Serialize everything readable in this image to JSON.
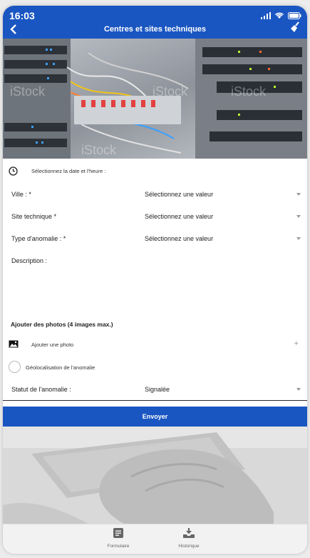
{
  "status_bar": {
    "time": "16:03"
  },
  "header": {
    "title": "Centres et sites techniques"
  },
  "hero": {
    "watermarks": [
      "iStock",
      "iStock",
      "iStock",
      "iStock"
    ]
  },
  "form": {
    "datetime_label": "Sélectionnez la date et l'heure :",
    "ville": {
      "label": "Ville : *",
      "value": "Sélectionnez une valeur"
    },
    "site": {
      "label": "Site technique *",
      "value": "Sélectionnez une valeur"
    },
    "anomalie_type": {
      "label": "Type d'anomalie : *",
      "value": "Sélectionnez une valeur"
    },
    "description": {
      "label": "Description :"
    },
    "photos_section": "Ajouter des photos (4 images max.)",
    "add_photo": "Ajouter une photo",
    "geoloc": "Géolocalisation de l'anomalie",
    "statut": {
      "label": "Statut de l'anomalie :",
      "value": "Signalée"
    }
  },
  "send_button": "Envoyer",
  "tabbar": [
    {
      "label": "Formulaire",
      "icon": "document-icon"
    },
    {
      "label": "Historique",
      "icon": "download-tray-icon"
    }
  ],
  "colors": {
    "primary": "#1a56c2"
  }
}
